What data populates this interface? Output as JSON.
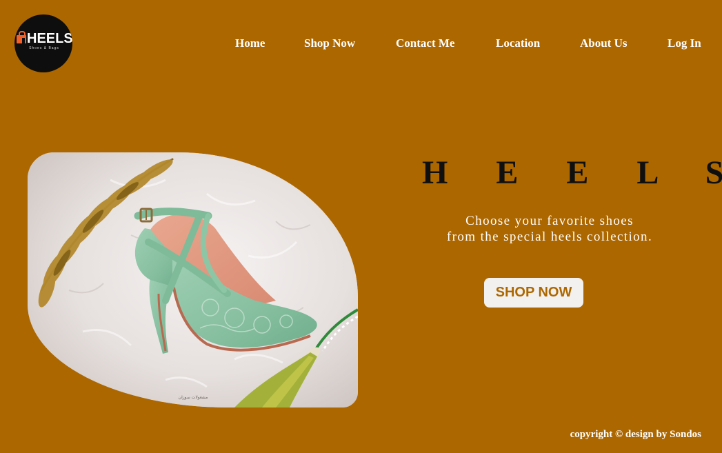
{
  "logo": {
    "title": "HEELS",
    "subtitle": "Shoes & Bags",
    "icon": "shopping-bag-icon",
    "background": "#0e0e0e",
    "accent": "#f0602a"
  },
  "nav": {
    "items": [
      {
        "label": "Home"
      },
      {
        "label": "Shop Now"
      },
      {
        "label": "Contact Me"
      },
      {
        "label": "Location"
      },
      {
        "label": "About Us"
      },
      {
        "label": "Log In"
      }
    ]
  },
  "hero": {
    "image_alt": "Mint green pointed high heel shoe with ankle strap on white fur",
    "image_watermark": "مشغولات سوزان",
    "title": "H E E L S",
    "tagline_line1": "Choose your favorite shoes",
    "tagline_line2": "from the special heels collection.",
    "cta_label": "SHOP NOW"
  },
  "footer": {
    "text": "copyright © design by Sondos"
  },
  "colors": {
    "page_background": "#ad6700",
    "button_background": "#f3f1ef",
    "button_text": "#ad6700",
    "text_light": "#ffffff",
    "text_dark": "#0f0f0f"
  }
}
